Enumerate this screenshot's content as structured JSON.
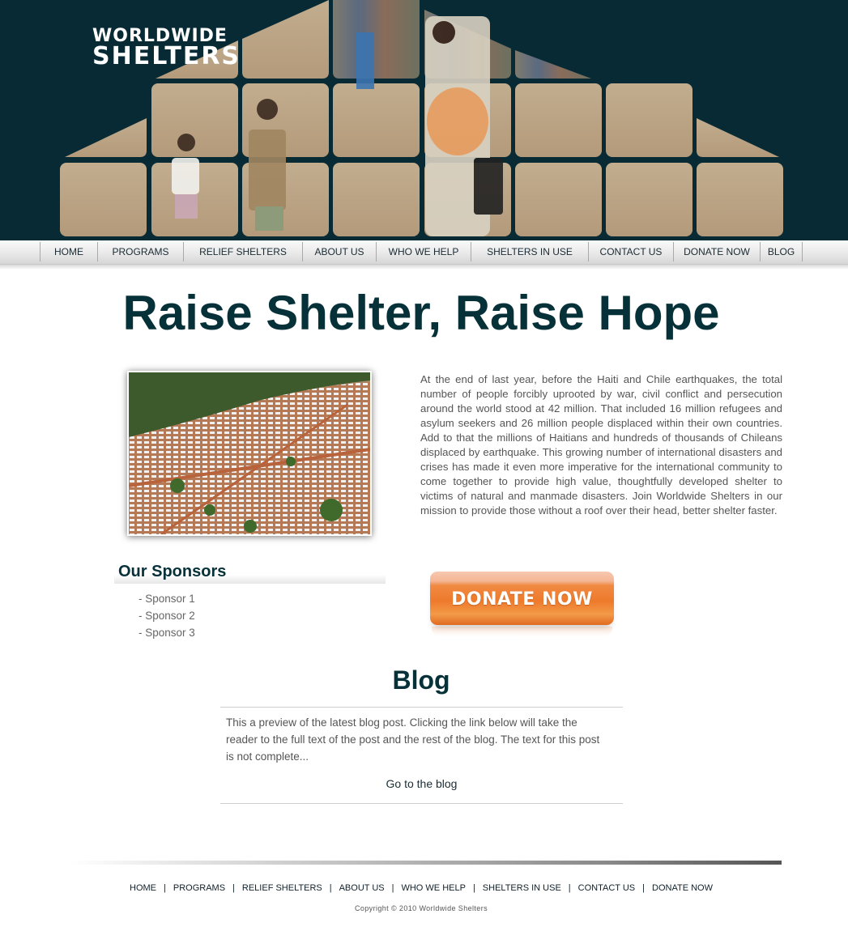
{
  "brand": {
    "logo_line1": "WORLDWIDE",
    "logo_line2": "SHELTERS",
    "bg_color": "#072a35",
    "accent_color": "#073139"
  },
  "nav": {
    "items": [
      {
        "label": "HOME"
      },
      {
        "label": "PROGRAMS"
      },
      {
        "label": "RELIEF SHELTERS"
      },
      {
        "label": "ABOUT US"
      },
      {
        "label": "WHO WE HELP"
      },
      {
        "label": "SHELTERS IN USE"
      },
      {
        "label": "CONTACT US"
      },
      {
        "label": "DONATE NOW"
      },
      {
        "label": "BLOG"
      }
    ]
  },
  "main": {
    "headline": "Raise Shelter, Raise Hope",
    "intro": "At the end of last year, before the Haiti and Chile earthquakes, the total number of people forcibly uprooted by war, civil conflict and persecution around the world stood at 42 million. That included 16 million refugees and asylum seekers and 26 million people displaced within their own countries. Add to that the millions of Haitians and hundreds of thousands of Chileans displaced by earthquake. This growing number of international disasters and crises has made it even more imperative for the international community to come together to provide high value, thoughtfully developed shelter to victims of natural and manmade disasters. Join Worldwide Shelters in our mission to provide those without a roof over their head, better shelter faster."
  },
  "sponsors": {
    "title": "Our Sponsors",
    "items": [
      "- Sponsor 1",
      "- Sponsor 2",
      "- Sponsor 3"
    ]
  },
  "donate": {
    "label": "DONATE NOW",
    "color": "#ee7a2c"
  },
  "blog": {
    "title": "Blog",
    "preview": "This a preview of the latest blog post. Clicking the link below will take the reader to the full text of the post and the rest of the blog. The text for this post is not complete...",
    "link": "Go to the blog"
  },
  "footer": {
    "links": [
      "HOME",
      "PROGRAMS",
      "RELIEF SHELTERS",
      "ABOUT US",
      "WHO WE HELP",
      "SHELTERS IN USE",
      "CONTACT US",
      "DONATE NOW"
    ],
    "separator": "|",
    "copyright": "Copyright © 2010 Worldwide Shelters"
  }
}
